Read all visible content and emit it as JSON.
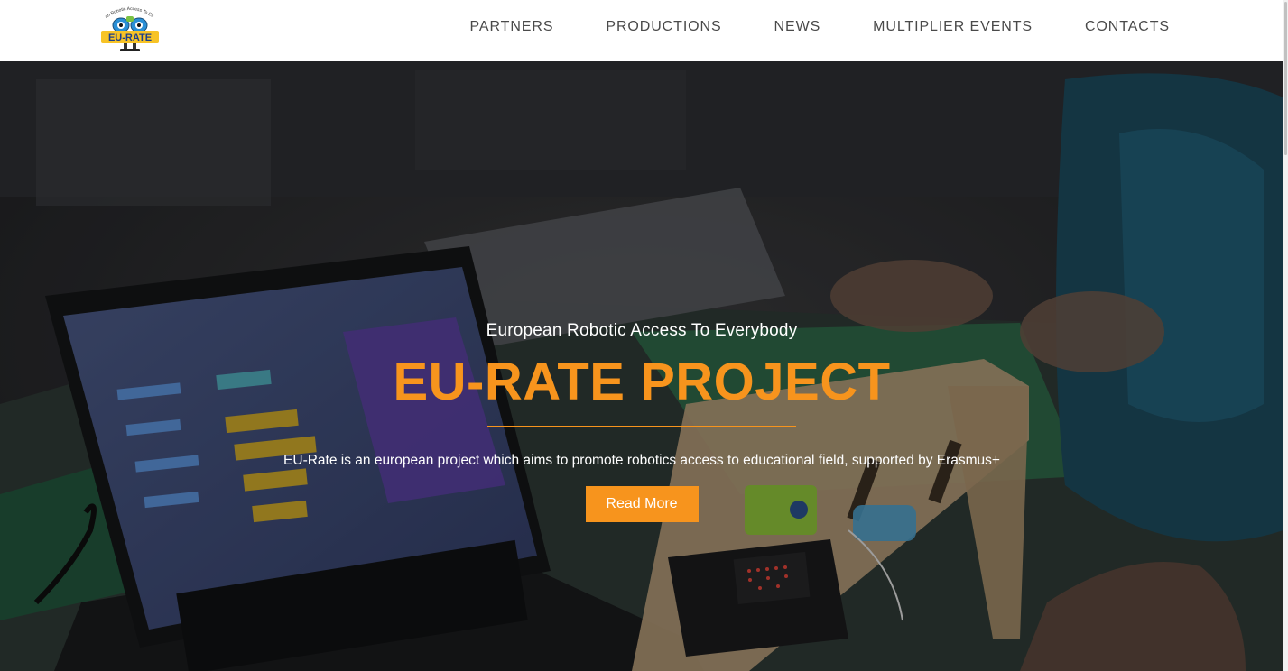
{
  "header": {
    "logo": {
      "tagline": "European Robotic Access To Everybody",
      "wordmark": "EU-RATE",
      "icon": "robot-logo-icon"
    },
    "nav": [
      {
        "label": "PARTNERS"
      },
      {
        "label": "PRODUCTIONS"
      },
      {
        "label": "NEWS"
      },
      {
        "label": "MULTIPLIER EVENTS"
      },
      {
        "label": "CONTACTS"
      }
    ]
  },
  "hero": {
    "tagline": "European Robotic Access To Everybody",
    "title": "EU-RATE PROJECT",
    "description": "EU-Rate is an european project which aims to promote robotics access to educational field, supported by Erasmus+",
    "cta_label": "Read More",
    "background_icon": "robotics-workshop-photo"
  },
  "colors": {
    "accent": "#f7941d",
    "nav_text": "#4a4a4a",
    "header_bg": "#ffffff"
  }
}
